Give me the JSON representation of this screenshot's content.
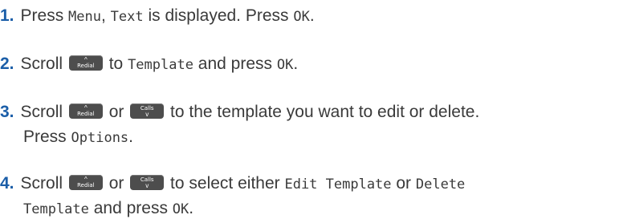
{
  "steps": [
    {
      "number": "1.",
      "parts": {
        "a": "Press ",
        "b": "Menu",
        "c": ", ",
        "d": "Text",
        "e": " is displayed. Press ",
        "f": "OK",
        "g": "."
      }
    },
    {
      "number": "2.",
      "parts": {
        "a": "Scroll ",
        "b": " to ",
        "c": "Template",
        "d": " and press ",
        "e": "OK",
        "f": "."
      }
    },
    {
      "number": "3.",
      "parts": {
        "a": "Scroll ",
        "b": " or ",
        "c": " to the template you want to edit or delete.",
        "d": "Press ",
        "e": "Options",
        "f": "."
      }
    },
    {
      "number": "4.",
      "parts": {
        "a": "Scroll ",
        "b": " or ",
        "c": " to select either ",
        "d": "Edit Template",
        "e": " or ",
        "f": "Delete",
        "g": "Template",
        "h": " and press ",
        "i": "OK",
        "j": "."
      }
    }
  ],
  "keys": {
    "redial": {
      "label": "Redial",
      "icon": "chevron-up-icon",
      "glyph": "^"
    },
    "calls": {
      "label": "Calls",
      "icon": "chevron-down-icon",
      "glyph": "v"
    }
  },
  "colors": {
    "step_number": "#1b5ea8",
    "text": "#3a3a3a",
    "key_bg": "#4d4d4d"
  }
}
